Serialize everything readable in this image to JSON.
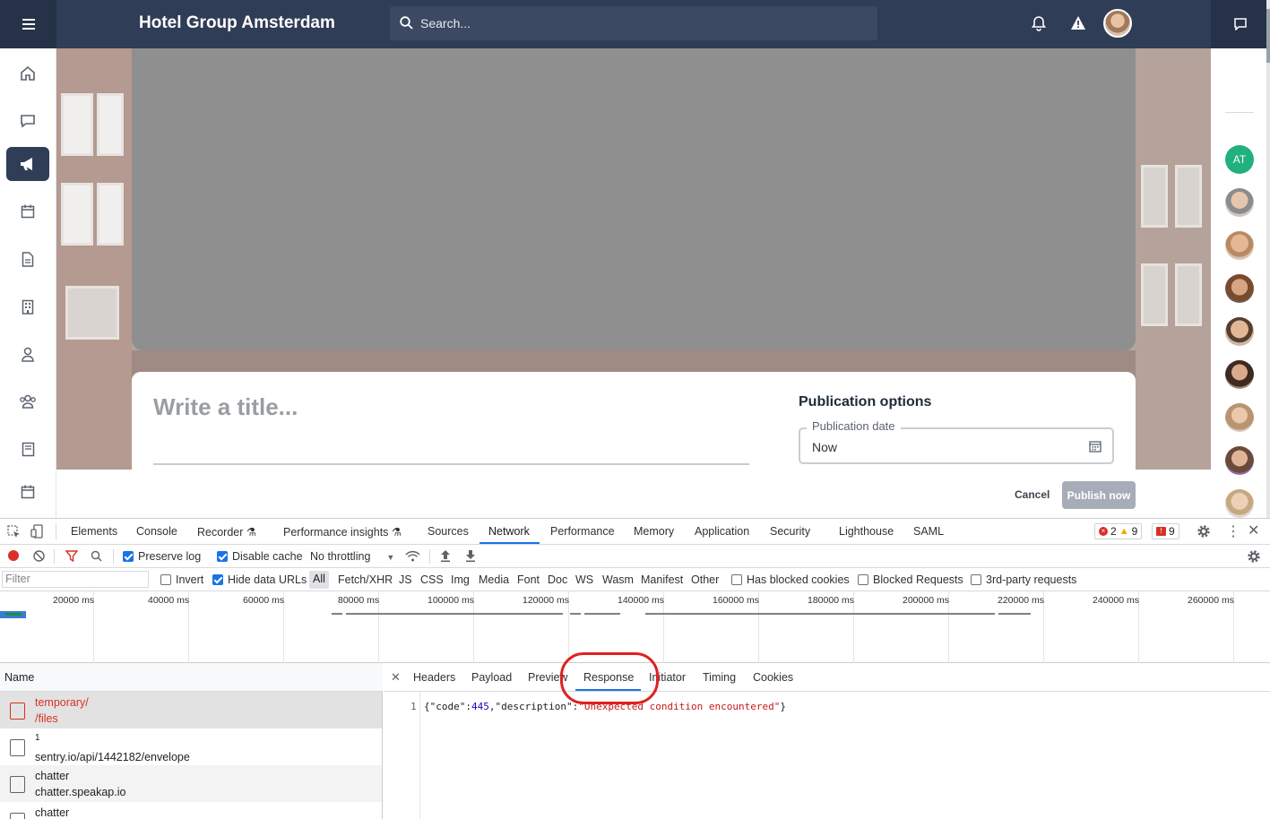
{
  "app": {
    "title": "Hotel Group Amsterdam",
    "search_placeholder": "Search...",
    "menu_icon": "hamburger-icon",
    "notification_icon": "bell-icon",
    "alert_icon": "warning-icon",
    "chat_icon": "chat-icon"
  },
  "sidebar": {
    "items": [
      {
        "icon": "home-icon"
      },
      {
        "icon": "chat-icon"
      },
      {
        "icon": "megaphone-icon",
        "active": true
      },
      {
        "icon": "calendar-icon"
      },
      {
        "icon": "document-icon"
      },
      {
        "icon": "building-icon"
      },
      {
        "icon": "person-icon"
      },
      {
        "icon": "group-icon"
      },
      {
        "icon": "book-icon"
      },
      {
        "icon": "calendar-icon"
      }
    ]
  },
  "editor": {
    "title_placeholder": "Write a title...",
    "publication_options_title": "Publication options",
    "publication_date_label": "Publication date",
    "publication_date_value": "Now",
    "cancel_label": "Cancel",
    "publish_label": "Publish now"
  },
  "rightbar": {
    "first_avatar_initials": "AT",
    "avatar_count": 9
  },
  "devtools": {
    "tabs": [
      "Elements",
      "Console",
      "Recorder",
      "Performance insights",
      "Sources",
      "Network",
      "Performance",
      "Memory",
      "Application",
      "Security",
      "Lighthouse",
      "SAML"
    ],
    "active_tab": "Network",
    "errors": "2",
    "warnings": "9",
    "issues": "9",
    "toolbar": {
      "preserve_log": "Preserve log",
      "disable_cache": "Disable cache",
      "throttling": "No throttling"
    },
    "filter": {
      "placeholder": "Filter",
      "invert": "Invert",
      "hide_data_urls": "Hide data URLs",
      "types": [
        "All",
        "Fetch/XHR",
        "JS",
        "CSS",
        "Img",
        "Media",
        "Font",
        "Doc",
        "WS",
        "Wasm",
        "Manifest",
        "Other"
      ],
      "has_blocked_cookies": "Has blocked cookies",
      "blocked_requests": "Blocked Requests",
      "third_party": "3rd-party requests"
    },
    "timeline_labels": [
      "20000 ms",
      "40000 ms",
      "60000 ms",
      "80000 ms",
      "100000 ms",
      "120000 ms",
      "140000 ms",
      "160000 ms",
      "180000 ms",
      "200000 ms",
      "220000 ms",
      "240000 ms",
      "260000 ms"
    ],
    "name_header": "Name",
    "requests": [
      {
        "line1": "temporary/",
        "line2": "/files",
        "error": true
      },
      {
        "line1": "1",
        "line2": "sentry.io/api/1442182/envelope"
      },
      {
        "line1": "chatter",
        "line2": "chatter.speakap.io"
      },
      {
        "line1": "chatter",
        "line2": ""
      }
    ],
    "detail_tabs": [
      "Headers",
      "Payload",
      "Preview",
      "Response",
      "Initiator",
      "Timing",
      "Cookies"
    ],
    "active_detail_tab": "Response",
    "response": {
      "line_number": "1",
      "prefix": "{\"code\":",
      "code": "445",
      "middle": ",\"description\":",
      "description": "\"Unexpected condition encountered\"",
      "suffix": "}"
    },
    "colors": {
      "accent": "#1a73e8",
      "error": "#d93025",
      "annotation": "#e02020"
    }
  }
}
